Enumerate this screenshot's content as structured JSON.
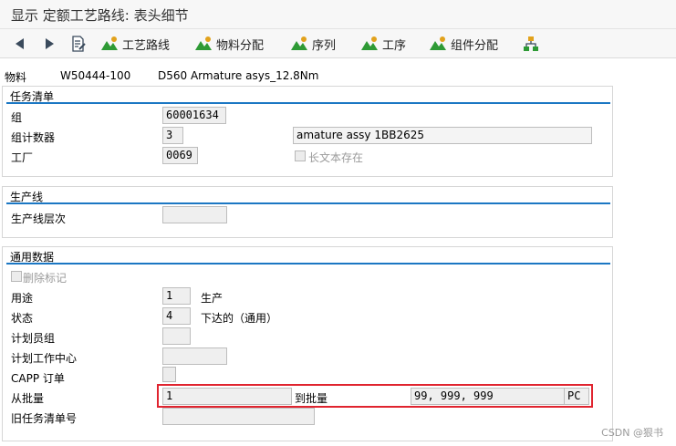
{
  "window": {
    "title": "显示 定额工艺路线: 表头细节"
  },
  "toolbar": {
    "items": [
      {
        "label": "工艺路线"
      },
      {
        "label": "物料分配"
      },
      {
        "label": "序列"
      },
      {
        "label": "工序"
      },
      {
        "label": "组件分配"
      }
    ]
  },
  "header": {
    "material_label": "物料",
    "material_number": "W50444-100",
    "material_desc": "D560 Armature asys_12.8Nm"
  },
  "task_list": {
    "title": "任务清单",
    "group_label": "组",
    "group_value": "60001634",
    "counter_label": "组计数器",
    "counter_value": "3",
    "counter_desc": "amature assy 1BB2625",
    "plant_label": "工厂",
    "plant_value": "0069",
    "longtext_label": "长文本存在"
  },
  "production_line": {
    "title": "生产线",
    "level_label": "生产线层次",
    "level_value": ""
  },
  "general": {
    "title": "通用数据",
    "delete_flag_label": "删除标记",
    "usage_label": "用途",
    "usage_value": "1",
    "usage_desc": "生产",
    "status_label": "状态",
    "status_value": "4",
    "status_desc": "下达的（通用）",
    "planner_label": "计划员组",
    "planner_value": "",
    "workcenter_label": "计划工作中心",
    "workcenter_value": "",
    "capp_label": "CAPP 订单",
    "from_lot_label": "从批量",
    "from_lot_value": "1",
    "to_lot_label": "到批量",
    "to_lot_value": "99, 999, 999",
    "unit_value": "PC",
    "old_task_label": "旧任务清单号",
    "old_task_value": ""
  },
  "watermark": "CSDN @狠书",
  "colors": {
    "accent_line": "#1b77c3",
    "highlight": "#e0242f",
    "icon_green": "#2e9a35",
    "icon_gold": "#e2a21c"
  }
}
